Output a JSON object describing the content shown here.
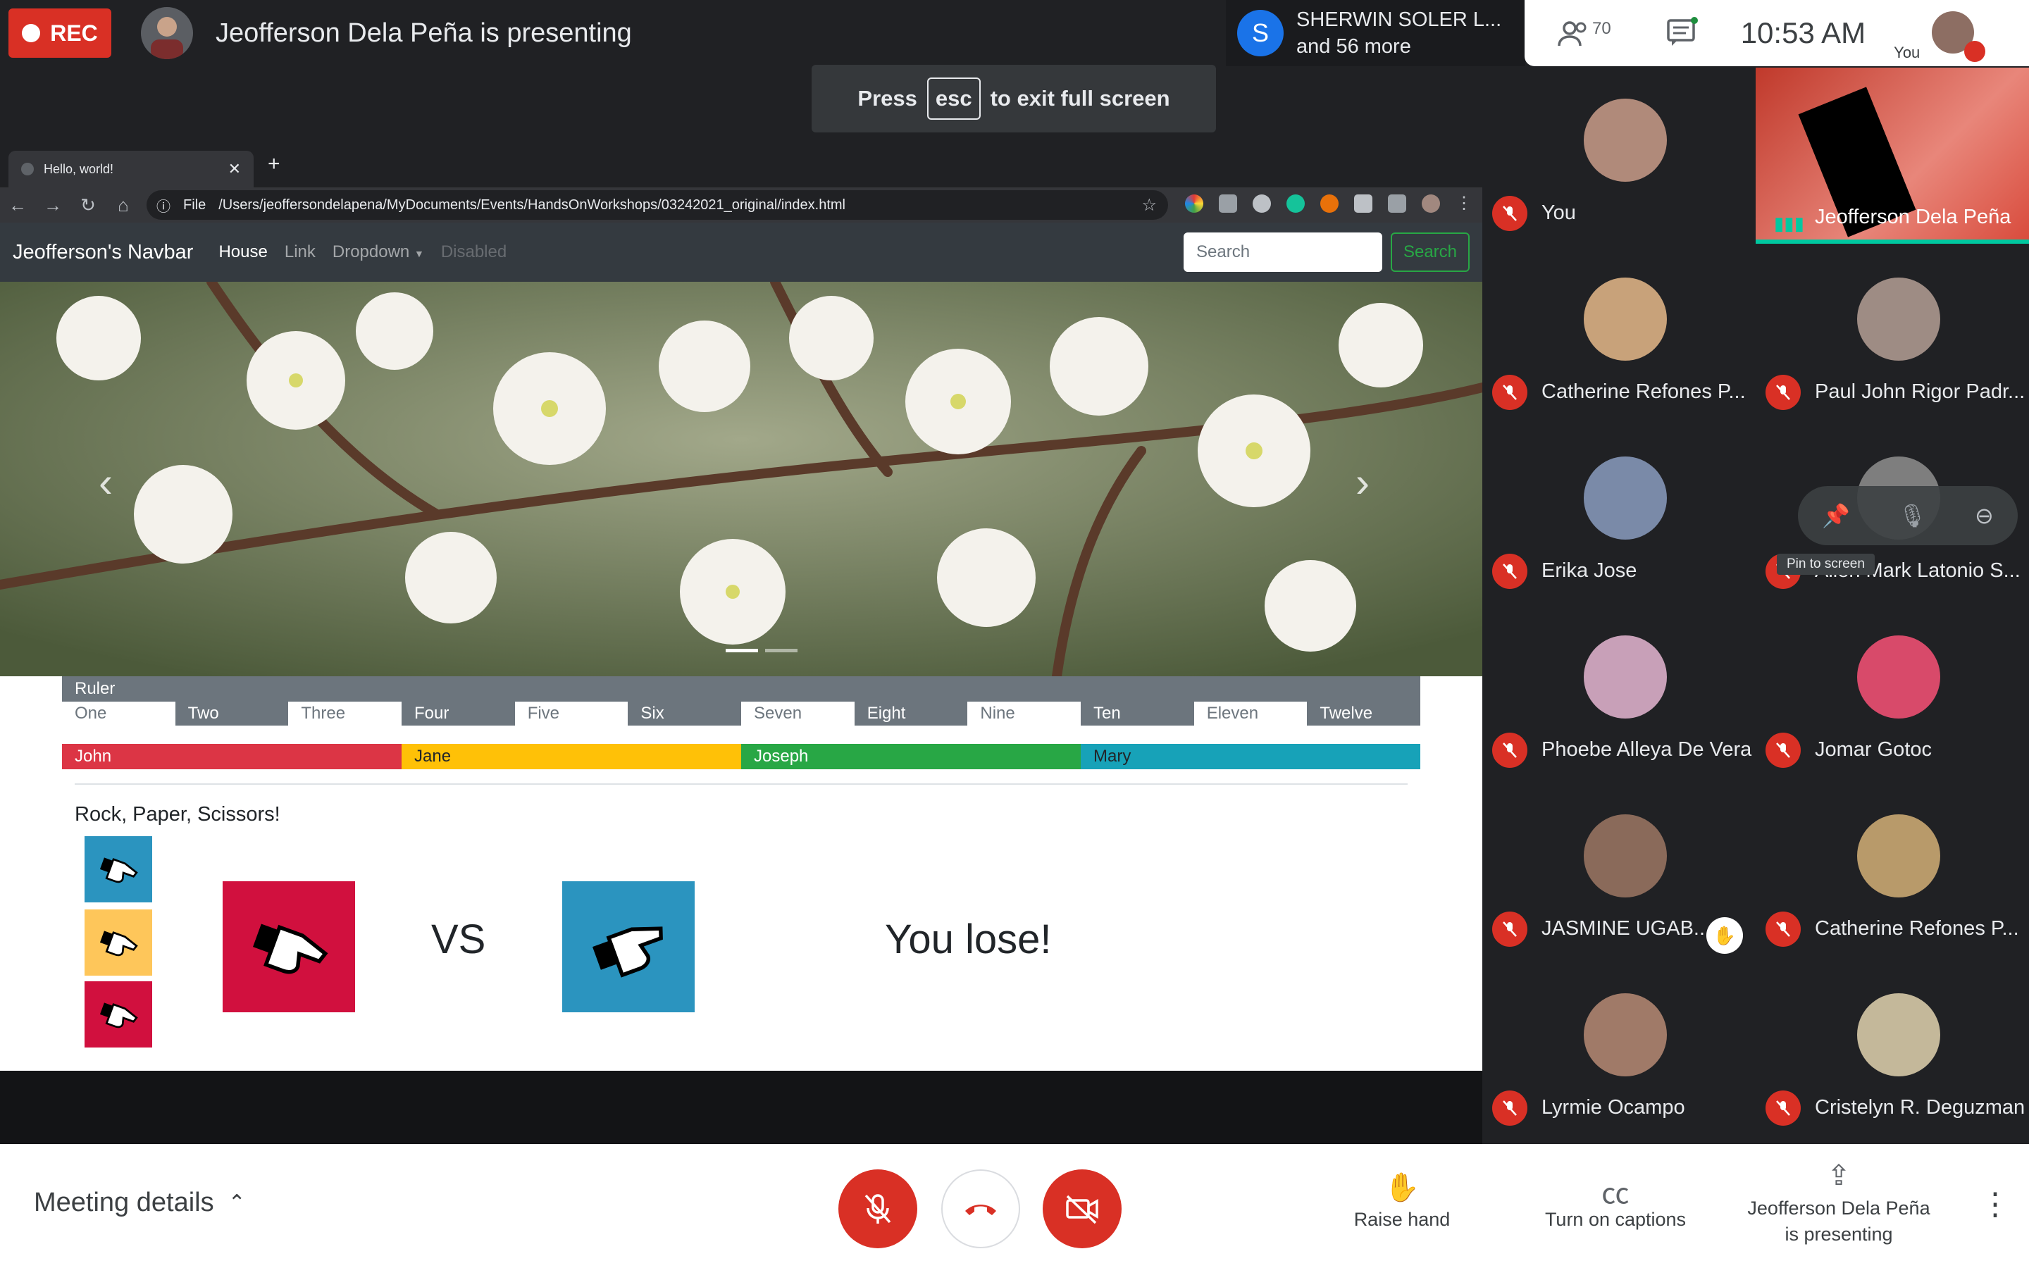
{
  "topbar": {
    "rec_label": "REC",
    "presenting": "Jeofferson Dela Peña is presenting",
    "sherwin_initial": "S",
    "sherwin_line1": "SHERWIN SOLER L...",
    "sherwin_line2": "and 56 more",
    "people_count": "70",
    "time": "10:53  AM",
    "you_label": "You"
  },
  "toast": {
    "press": "Press",
    "key": "esc",
    "rest": "to exit full screen"
  },
  "browser": {
    "tab_title": "Hello, world!",
    "scheme": "File",
    "url": "/Users/jeoffersondelapena/MyDocuments/Events/HandsOnWorkshops/03242021_original/index.html"
  },
  "navbar": {
    "brand": "Jeofferson's Navbar",
    "links": [
      "House",
      "Link",
      "Dropdown",
      "Disabled"
    ],
    "search_placeholder": "Search",
    "search_button": "Search"
  },
  "ruler": {
    "title": "Ruler",
    "cells": [
      "One",
      "Two",
      "Three",
      "Four",
      "Five",
      "Six",
      "Seven",
      "Eight",
      "Nine",
      "Ten",
      "Eleven",
      "Twelve"
    ]
  },
  "names": [
    {
      "label": "John",
      "color": "#dc3545",
      "text": "#ffffff"
    },
    {
      "label": "Jane",
      "color": "#ffc107",
      "text": "#212529"
    },
    {
      "label": "Joseph",
      "color": "#28a745",
      "text": "#ffffff"
    },
    {
      "label": "Mary",
      "color": "#17a2b8",
      "text": "#212529"
    }
  ],
  "rps": {
    "title": "Rock, Paper, Scissors!",
    "vs": "VS",
    "result": "You lose!",
    "colors": {
      "rock": "#2b94bf",
      "paper": "#fec65a",
      "scissors": "#d1103e"
    }
  },
  "participants": [
    {
      "name": "You"
    },
    {
      "name": "Jeofferson Dela Peña"
    },
    {
      "name": "Catherine Refones P..."
    },
    {
      "name": "Paul John Rigor Padr..."
    },
    {
      "name": "Erika Jose"
    },
    {
      "name": "Allen Mark Latonio S..."
    },
    {
      "name": "Phoebe Alleya De Vera"
    },
    {
      "name": "Jomar Gotoc"
    },
    {
      "name": "JASMINE UGAB..."
    },
    {
      "name": "Catherine Refones P..."
    },
    {
      "name": "Lyrmie Ocampo"
    },
    {
      "name": "Cristelyn R. Deguzman"
    }
  ],
  "pin_tooltip": "Pin to screen",
  "bottombar": {
    "meeting_details": "Meeting details",
    "raise_hand": "Raise hand",
    "captions": "Turn on captions",
    "presenting_line1": "Jeofferson Dela Peña",
    "presenting_line2": "is presenting"
  }
}
